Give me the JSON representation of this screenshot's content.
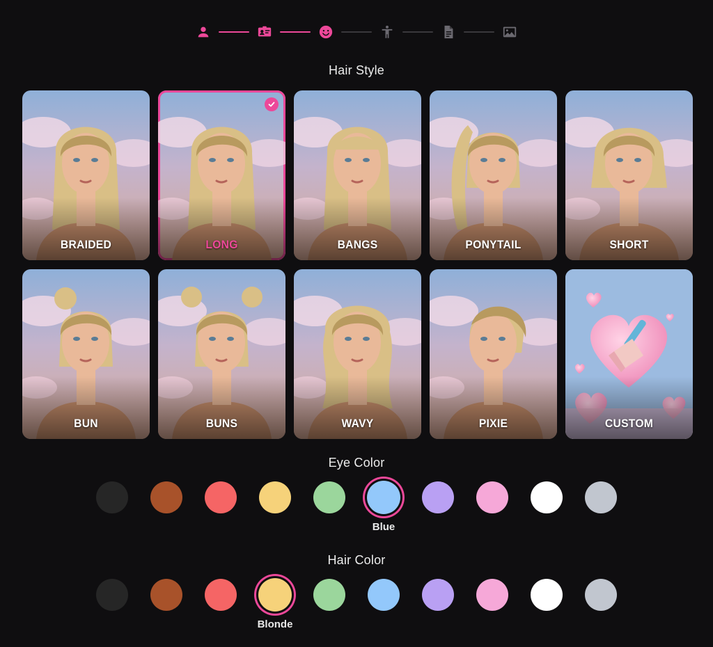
{
  "stepper": {
    "steps": [
      {
        "icon": "person-icon",
        "state": "done"
      },
      {
        "icon": "id-card-icon",
        "state": "done"
      },
      {
        "icon": "smiley-face-icon",
        "state": "active"
      },
      {
        "icon": "body-figure-icon",
        "state": "pending"
      },
      {
        "icon": "document-icon",
        "state": "pending"
      },
      {
        "icon": "image-icon",
        "state": "pending"
      }
    ],
    "active_color": "#ec4899",
    "inactive_color": "#6b6970"
  },
  "hair_style": {
    "title": "Hair Style",
    "selected": "LONG",
    "options": [
      {
        "label": "BRAIDED"
      },
      {
        "label": "LONG"
      },
      {
        "label": "BANGS"
      },
      {
        "label": "PONYTAIL"
      },
      {
        "label": "SHORT"
      },
      {
        "label": "BUN"
      },
      {
        "label": "BUNS"
      },
      {
        "label": "WAVY"
      },
      {
        "label": "PIXIE"
      },
      {
        "label": "CUSTOM"
      }
    ]
  },
  "eye_color": {
    "title": "Eye Color",
    "selected_label": "Blue",
    "selected_index": 5,
    "swatches": [
      "#262626",
      "#a8522a",
      "#f56565",
      "#f6d27a",
      "#9bd69c",
      "#93c8fb",
      "#b9a0f3",
      "#f6a8d8",
      "#ffffff",
      "#c1c6cf"
    ]
  },
  "hair_color": {
    "title": "Hair Color",
    "selected_label": "Blonde",
    "selected_index": 3,
    "swatches": [
      "#262626",
      "#a8522a",
      "#f56565",
      "#f6d27a",
      "#9bd69c",
      "#93c8fb",
      "#b9a0f3",
      "#f6a8d8",
      "#ffffff",
      "#c1c6cf"
    ]
  },
  "colors": {
    "accent": "#ec4899",
    "background": "#0f0e10"
  }
}
